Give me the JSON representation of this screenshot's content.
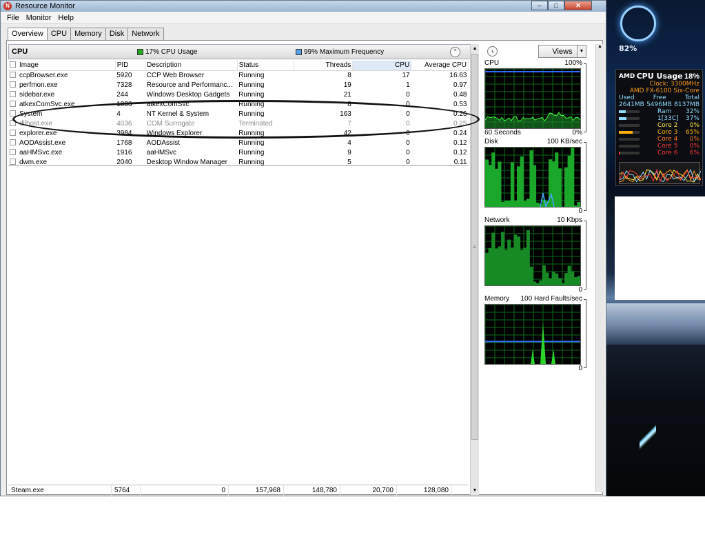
{
  "window": {
    "title": "Resource Monitor",
    "app_icon_glyph": "N",
    "controls": {
      "minimize": "–",
      "maximize": "□",
      "close": "✕"
    }
  },
  "menu": [
    "File",
    "Monitor",
    "Help"
  ],
  "tabs": [
    "Overview",
    "CPU",
    "Memory",
    "Disk",
    "Network"
  ],
  "active_tab": "Overview",
  "cpu_section": {
    "title": "CPU",
    "usage_label": "17% CPU Usage",
    "usage_color": "#22aa22",
    "freq_label": "99% Maximum Frequency",
    "freq_color": "#5aa0ea",
    "collapse_glyph": "⌃"
  },
  "columns": [
    "Image",
    "PID",
    "Description",
    "Status",
    "Threads",
    "CPU",
    "Average CPU"
  ],
  "rows": [
    {
      "image": "ccpBrowser.exe",
      "pid": "5920",
      "description": "CCP Web Browser",
      "status": "Running",
      "threads": "8",
      "cpu": "17",
      "avg": "16.63"
    },
    {
      "image": "perfmon.exe",
      "pid": "7328",
      "description": "Resource and Performanc...",
      "status": "Running",
      "threads": "19",
      "cpu": "1",
      "avg": "0.97"
    },
    {
      "image": "sidebar.exe",
      "pid": "244",
      "description": "Windows Desktop Gadgets",
      "status": "Running",
      "threads": "21",
      "cpu": "0",
      "avg": "0.48"
    },
    {
      "image": "atkexComSvc.exe",
      "pid": "1836",
      "description": "atkexComSvc",
      "status": "Running",
      "threads": "8",
      "cpu": "0",
      "avg": "0.53"
    },
    {
      "image": "System",
      "pid": "4",
      "description": "NT Kernel & System",
      "status": "Running",
      "threads": "163",
      "cpu": "0",
      "avg": "0.26"
    },
    {
      "image": "dllhost.exe",
      "pid": "4036",
      "description": "COM Surrogate",
      "status": "Terminated",
      "threads": "7",
      "cpu": "0",
      "avg": "0.25"
    },
    {
      "image": "explorer.exe",
      "pid": "3984",
      "description": "Windows Explorer",
      "status": "Running",
      "threads": "42",
      "cpu": "0",
      "avg": "0.24"
    },
    {
      "image": "AODAssist.exe",
      "pid": "1768",
      "description": "AODAssist",
      "status": "Running",
      "threads": "4",
      "cpu": "0",
      "avg": "0.12"
    },
    {
      "image": "aaHMSvc.exe",
      "pid": "1916",
      "description": "aaHMSvc",
      "status": "Running",
      "threads": "9",
      "cpu": "0",
      "avg": "0.12"
    },
    {
      "image": "dwm.exe",
      "pid": "2040",
      "description": "Desktop Window Manager",
      "status": "Running",
      "threads": "5",
      "cpu": "0",
      "avg": "0.11"
    }
  ],
  "bottom_row": [
    "Steam.exe",
    "5764",
    "0",
    "157,968",
    "148,780",
    "20,700",
    "128,080"
  ],
  "right_panel": {
    "expand_glyph": "›",
    "views_label": "Views",
    "views_arrow": "▼",
    "graphs": [
      {
        "name": "CPU",
        "max": "100%",
        "bottom_left": "60 Seconds",
        "bottom_right": "0%"
      },
      {
        "name": "Disk",
        "max": "100 KB/sec",
        "bottom_left": "",
        "bottom_right": "0"
      },
      {
        "name": "Network",
        "max": "10 Kbps",
        "bottom_left": "",
        "bottom_right": "0"
      },
      {
        "name": "Memory",
        "max": "100 Hard Faults/sec",
        "bottom_left": "",
        "bottom_right": "0"
      }
    ]
  },
  "desktop": {
    "percent": "82%"
  },
  "gadget": {
    "brand": "AMD",
    "title": "CPU Usage",
    "total": "18%",
    "clock": "Clock: 3300MHz",
    "model": "AMD FX-6100 Six-Core",
    "headers": [
      "Used",
      "Free",
      "Total"
    ],
    "values": [
      "2641MB",
      "5496MB",
      "8137MB"
    ],
    "cores": [
      {
        "label": "Ram",
        "value": "32%",
        "color": "#8fdcff",
        "level": 0.32
      },
      {
        "label": "1[33C]",
        "value": "37%",
        "color": "#8fdcff",
        "level": 0.37
      },
      {
        "label": "Core 2",
        "value": "0%",
        "color": "#ffe640",
        "level": 0.0
      },
      {
        "label": "Core 3",
        "value": "65%",
        "color": "#ffb000",
        "level": 0.65
      },
      {
        "label": "Core 4",
        "value": "0%",
        "color": "#ff7a1f",
        "level": 0.0
      },
      {
        "label": "Core 5",
        "value": "0%",
        "color": "#ff3b3b",
        "level": 0.0
      },
      {
        "label": "Core 6",
        "value": "6%",
        "color": "#ff3b3b",
        "level": 0.06
      }
    ]
  }
}
